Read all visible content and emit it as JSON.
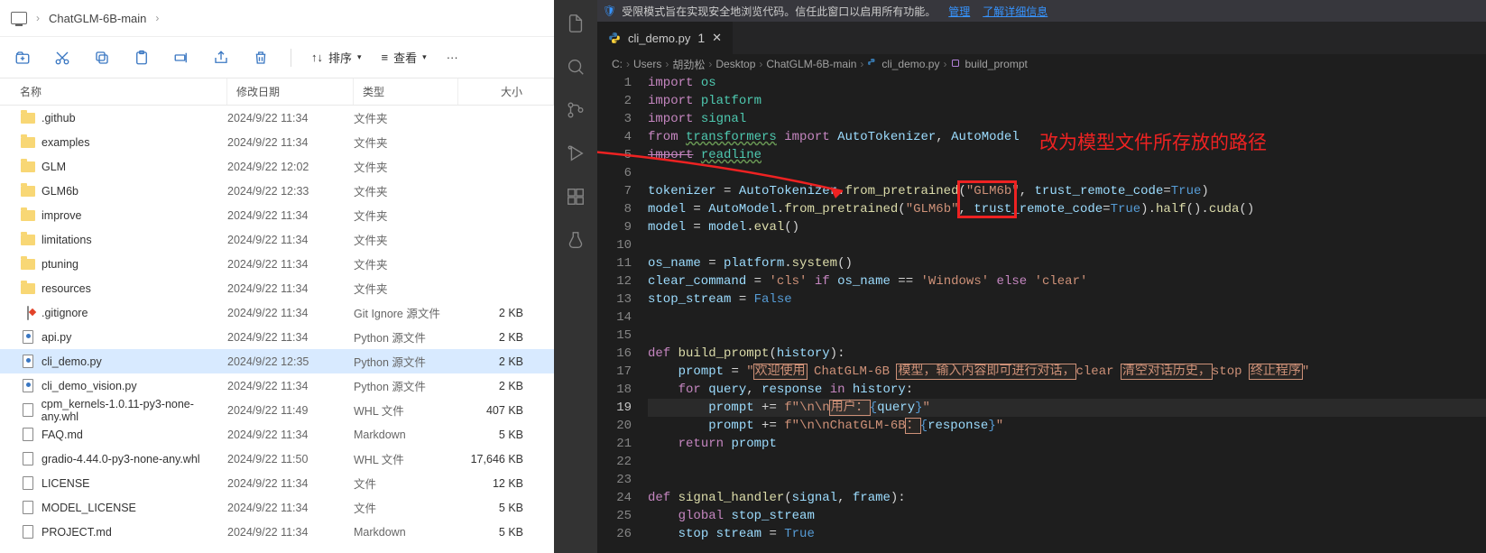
{
  "explorer": {
    "crumbs": [
      "ChatGLM-6B-main"
    ],
    "toolbar": {
      "sort": "排序",
      "view": "查看"
    },
    "headers": {
      "name": "名称",
      "date": "修改日期",
      "type": "类型",
      "size": "大小"
    },
    "files": [
      {
        "icon": "folder",
        "name": ".github",
        "date": "2024/9/22 11:34",
        "type": "文件夹",
        "size": ""
      },
      {
        "icon": "folder",
        "name": "examples",
        "date": "2024/9/22 11:34",
        "type": "文件夹",
        "size": ""
      },
      {
        "icon": "folder",
        "name": "GLM",
        "date": "2024/9/22 12:02",
        "type": "文件夹",
        "size": ""
      },
      {
        "icon": "folder",
        "name": "GLM6b",
        "date": "2024/9/22 12:33",
        "type": "文件夹",
        "size": ""
      },
      {
        "icon": "folder",
        "name": "improve",
        "date": "2024/9/22 11:34",
        "type": "文件夹",
        "size": ""
      },
      {
        "icon": "folder",
        "name": "limitations",
        "date": "2024/9/22 11:34",
        "type": "文件夹",
        "size": ""
      },
      {
        "icon": "folder",
        "name": "ptuning",
        "date": "2024/9/22 11:34",
        "type": "文件夹",
        "size": ""
      },
      {
        "icon": "folder",
        "name": "resources",
        "date": "2024/9/22 11:34",
        "type": "文件夹",
        "size": ""
      },
      {
        "icon": "git",
        "name": ".gitignore",
        "date": "2024/9/22 11:34",
        "type": "Git Ignore 源文件",
        "size": "2 KB"
      },
      {
        "icon": "py",
        "name": "api.py",
        "date": "2024/9/22 11:34",
        "type": "Python 源文件",
        "size": "2 KB"
      },
      {
        "icon": "py",
        "name": "cli_demo.py",
        "date": "2024/9/22 12:35",
        "type": "Python 源文件",
        "size": "2 KB",
        "selected": true
      },
      {
        "icon": "py",
        "name": "cli_demo_vision.py",
        "date": "2024/9/22 11:34",
        "type": "Python 源文件",
        "size": "2 KB"
      },
      {
        "icon": "file",
        "name": "cpm_kernels-1.0.11-py3-none-any.whl",
        "date": "2024/9/22 11:49",
        "type": "WHL 文件",
        "size": "407 KB"
      },
      {
        "icon": "file",
        "name": "FAQ.md",
        "date": "2024/9/22 11:34",
        "type": "Markdown",
        "size": "5 KB"
      },
      {
        "icon": "file",
        "name": "gradio-4.44.0-py3-none-any.whl",
        "date": "2024/9/22 11:50",
        "type": "WHL 文件",
        "size": "17,646 KB"
      },
      {
        "icon": "file",
        "name": "LICENSE",
        "date": "2024/9/22 11:34",
        "type": "文件",
        "size": "12 KB"
      },
      {
        "icon": "file",
        "name": "MODEL_LICENSE",
        "date": "2024/9/22 11:34",
        "type": "文件",
        "size": "5 KB"
      },
      {
        "icon": "file",
        "name": "PROJECT.md",
        "date": "2024/9/22 11:34",
        "type": "Markdown",
        "size": "5 KB"
      }
    ]
  },
  "editor": {
    "restricted": {
      "text": "受限模式旨在实现安全地浏览代码。信任此窗口以启用所有功能。",
      "link1": "管理",
      "link2": "了解详细信息"
    },
    "tab": {
      "name": "cli_demo.py",
      "modified": "1"
    },
    "breadcrumb": [
      "C:",
      "Users",
      "胡劲松",
      "Desktop",
      "ChatGLM-6B-main",
      "cli_demo.py",
      "build_prompt"
    ],
    "lines": [
      1,
      2,
      3,
      4,
      5,
      6,
      7,
      8,
      9,
      10,
      11,
      12,
      13,
      14,
      15,
      16,
      17,
      18,
      19,
      20,
      21,
      22,
      23,
      24,
      25,
      26
    ],
    "currentLine": 19,
    "code": {
      "l1": "import os",
      "l2": "import platform",
      "l3": "import signal",
      "l4a": "from ",
      "l4b": "transformers",
      "l4c": " import AutoTokenizer, AutoModel",
      "l5a": "import ",
      "l5b": "readline",
      "l7": "tokenizer = AutoTokenizer.from_pretrained(",
      "l7s": "\"GLM6b\"",
      "l7t": ", trust_remote_code=",
      "l7true": "True",
      "l7e": ")",
      "l8": "model = AutoModel.from_pretrained(",
      "l8s": "\"GLM6b\"",
      "l8t": ", trust_remote_code=",
      "l8true": "True",
      "l8e": ").half().cuda()",
      "l9": "model = model.eval()",
      "l11": "os_name = platform.system()",
      "l12a": "clear_command = ",
      "l12b": "'cls'",
      "l12c": " if os_name == ",
      "l12d": "'Windows'",
      "l12e": " else ",
      "l12f": "'clear'",
      "l13a": "stop_stream = ",
      "l13b": "False",
      "l16a": "def ",
      "l16b": "build_prompt",
      "l16c": "(history):",
      "l17a": "    prompt = ",
      "l17b": "\"",
      "l17c": "欢迎使用",
      "l17d": " ChatGLM-6B ",
      "l17e": "模型，输入内容即可进行对话，",
      "l17f": "clear ",
      "l17g": "清空对话历史，",
      "l17h": "stop ",
      "l17i": "终止程序",
      "l17j": "\"",
      "l18a": "    for query, response in history:",
      "l19a": "        prompt += ",
      "l19b": "f\"\\n\\n",
      "l19c": "用户：",
      "l19d": "{",
      "l19e": "query",
      "l19f": "}",
      "l19g": "\"",
      "l20a": "        prompt += ",
      "l20b": "f\"\\n\\nChatGLM-6B",
      "l20c": "：",
      "l20d": "{",
      "l20e": "response",
      "l20f": "}",
      "l20g": "\"",
      "l21": "    return prompt",
      "l24a": "def ",
      "l24b": "signal_handler",
      "l24c": "(signal, frame):",
      "l25": "    global stop_stream",
      "l26": "    stop stream = True"
    },
    "annotation": "改为模型文件所存放的路径"
  }
}
